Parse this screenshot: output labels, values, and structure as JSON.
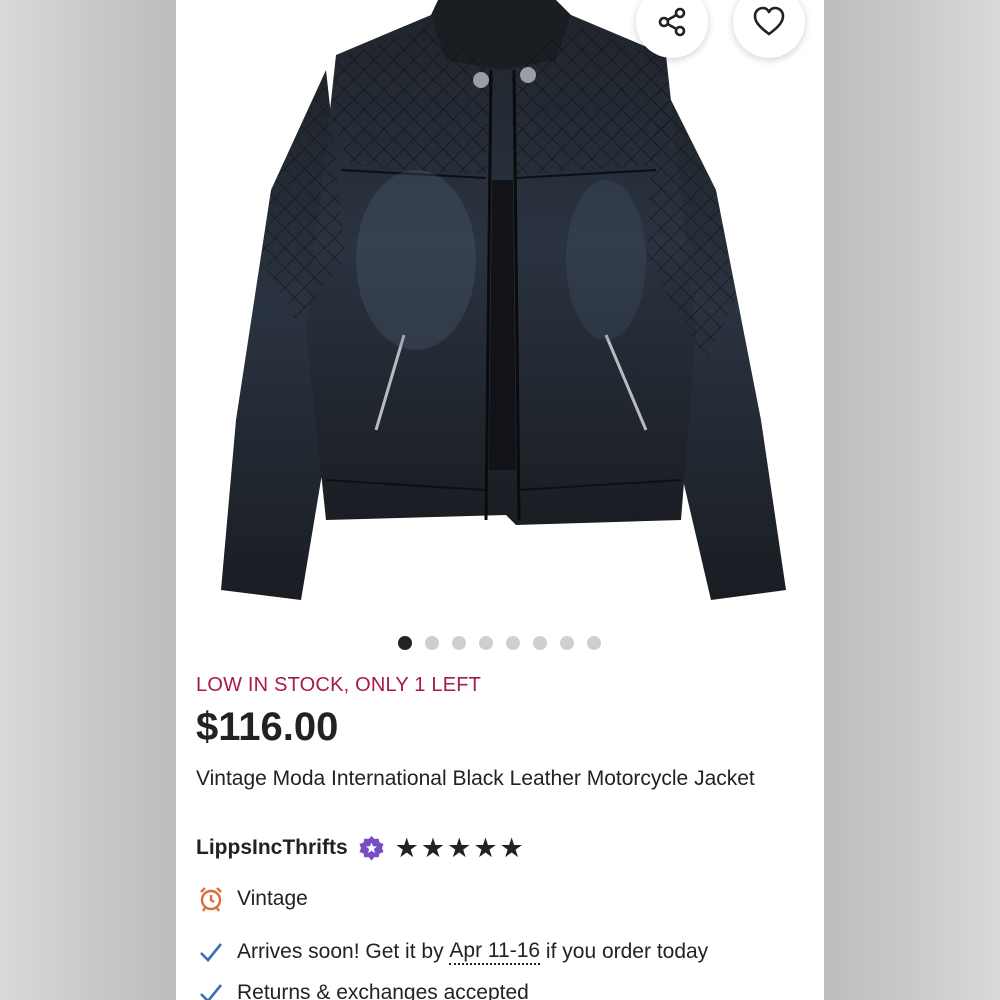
{
  "listing": {
    "image_alt": "Black leather motorcycle jacket with quilted shoulders",
    "carousel": {
      "count": 8,
      "active": 1
    },
    "stock_text": "LOW IN STOCK, ONLY 1 LEFT",
    "price": "$116.00",
    "title": "Vintage Moda International Black Leather Motorcycle Jacket",
    "seller": {
      "name": "LippsIncThrifts",
      "rating_stars": 5
    },
    "features": {
      "vintage": "Vintage",
      "arrival_prefix": "Arrives soon! Get it by ",
      "arrival_dates": "Apr 11-16",
      "arrival_suffix": " if you order today",
      "returns": "Returns & exchanges accepted"
    },
    "icons": {
      "share": "share-icon",
      "favorite": "heart-icon",
      "badge": "star-seller-badge-icon",
      "vintage": "alarm-clock-icon",
      "check": "checkmark-icon"
    },
    "colors": {
      "stock": "#a61a4c",
      "badge": "#7a4cc4",
      "vintage_icon": "#d9703b",
      "check": "#3b6fb6"
    }
  }
}
